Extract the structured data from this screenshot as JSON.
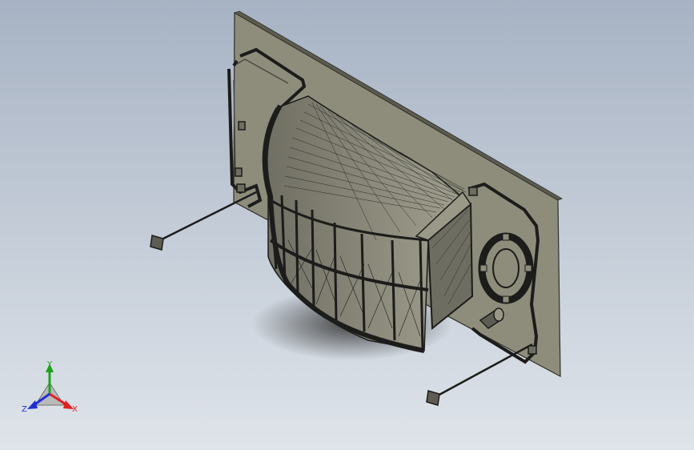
{
  "viewport": {
    "background_top": "#a7b3c4",
    "background_bottom": "#dfe4ea"
  },
  "model": {
    "panel_color": "#8e8d7c",
    "panel_edge_color": "#2e2e28",
    "body_color": "#7d7c6d",
    "shadow_color": "#3a3a36"
  },
  "triad": {
    "x_label": "X",
    "y_label": "Y",
    "z_label": "Z",
    "x_color": "#e02020",
    "y_color": "#20a020",
    "z_color": "#2030d0"
  }
}
